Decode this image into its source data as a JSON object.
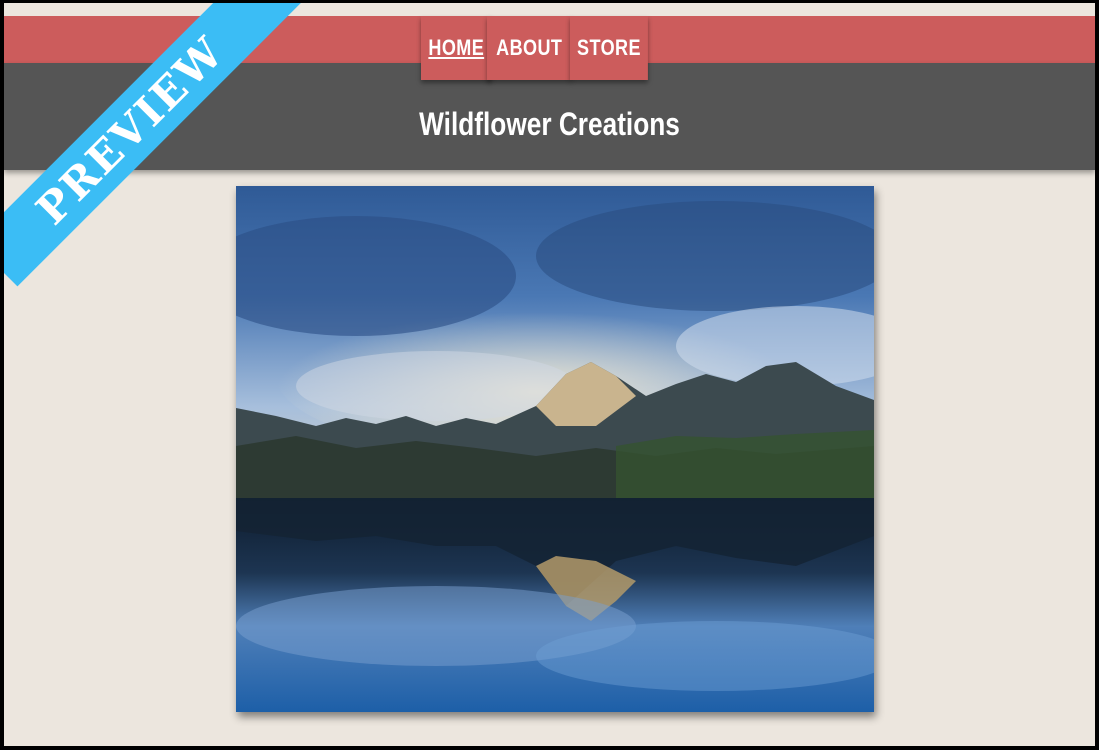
{
  "nav": {
    "items": [
      {
        "label": "HOME",
        "active": true
      },
      {
        "label": "ABOUT",
        "active": false
      },
      {
        "label": "STORE",
        "active": false
      }
    ]
  },
  "header": {
    "site_title": "Wildflower Creations"
  },
  "hero": {
    "alt": "mountain-lake-landscape"
  },
  "ribbon": {
    "label": "PREVIEW"
  },
  "colors": {
    "nav_red": "#cc5c5c",
    "header_gray": "#555555",
    "page_bg": "#ece6de",
    "ribbon_blue": "#3bbdf5"
  }
}
